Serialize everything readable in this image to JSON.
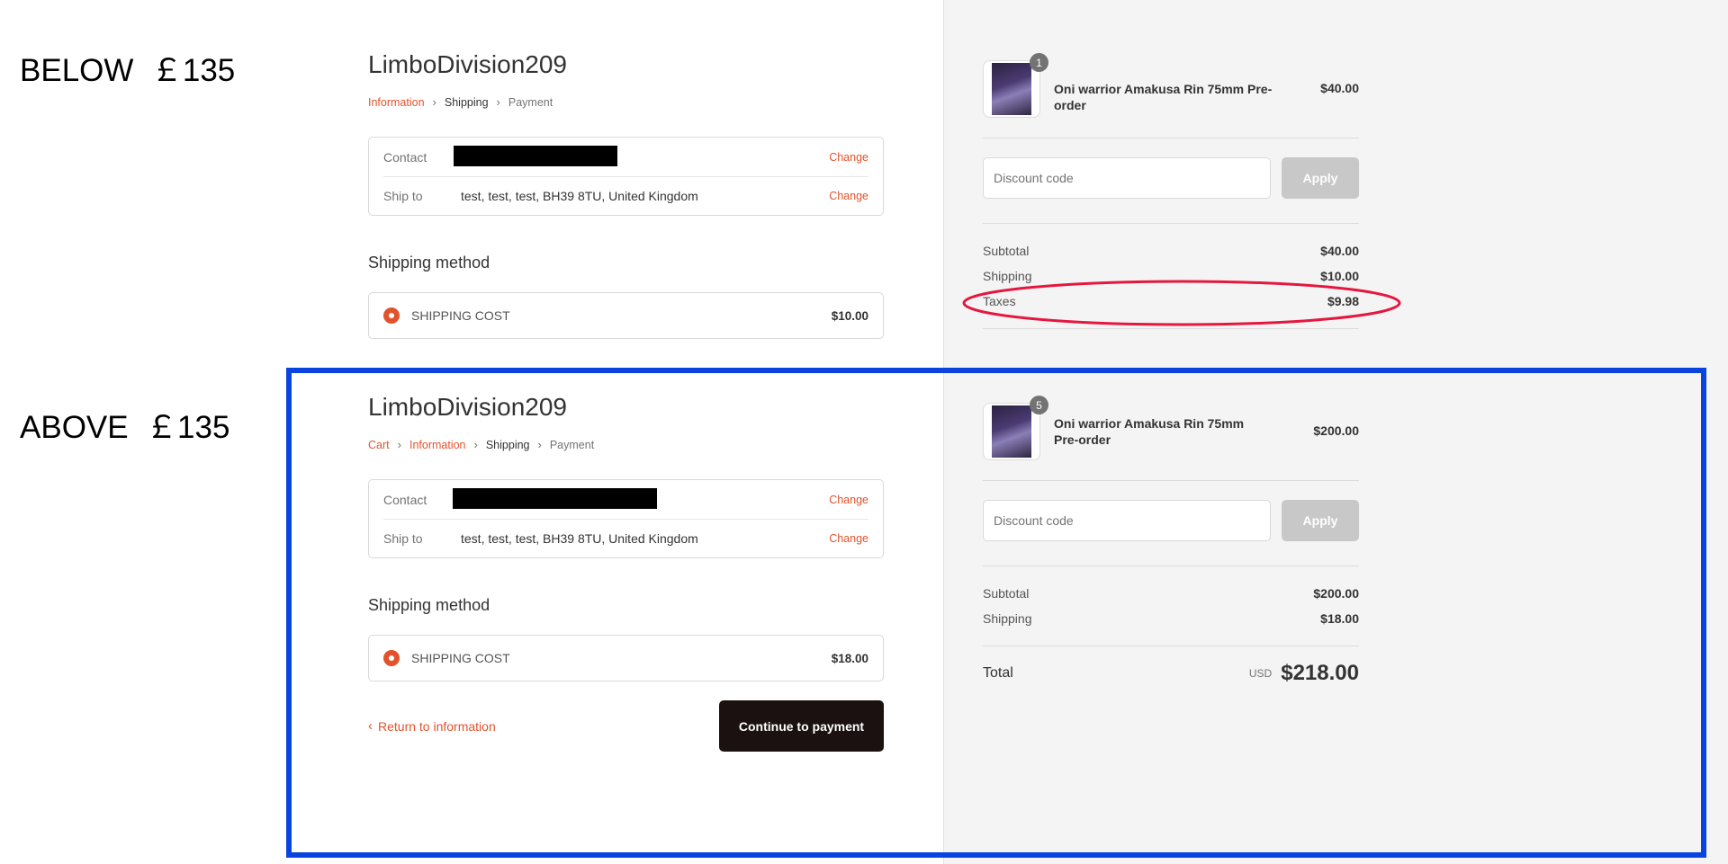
{
  "annotations": {
    "below_label": "BELOW  ￡135",
    "above_label": "ABOVE  ￡135",
    "highlight_color": "#e5173f",
    "frame_color": "#0a44e0"
  },
  "colors": {
    "accent": "#e2532d",
    "button_dark": "#1a1110",
    "panel_bg": "#f4f4f4"
  },
  "top": {
    "shop_title": "LimboDivision209",
    "breadcrumb": {
      "information": "Information",
      "shipping": "Shipping",
      "payment": "Payment"
    },
    "contact": {
      "label": "Contact",
      "change": "Change"
    },
    "ship_to": {
      "label": "Ship to",
      "value": "test, test, test, BH39 8TU, United Kingdom",
      "change": "Change"
    },
    "shipping_method_title": "Shipping method",
    "shipping_option": {
      "name": "SHIPPING COST",
      "price": "$10.00"
    },
    "order": {
      "product_name": "Oni warrior Amakusa Rin 75mm Pre-order",
      "product_price": "$40.00",
      "quantity": "1",
      "discount_placeholder": "Discount code",
      "apply_label": "Apply",
      "subtotal_label": "Subtotal",
      "subtotal_value": "$40.00",
      "shipping_label": "Shipping",
      "shipping_value": "$10.00",
      "taxes_label": "Taxes",
      "taxes_value": "$9.98"
    }
  },
  "bottom": {
    "shop_title": "LimboDivision209",
    "breadcrumb": {
      "cart": "Cart",
      "information": "Information",
      "shipping": "Shipping",
      "payment": "Payment"
    },
    "contact": {
      "label": "Contact",
      "change": "Change"
    },
    "ship_to": {
      "label": "Ship to",
      "value": "test, test, test, BH39 8TU, United Kingdom",
      "change": "Change"
    },
    "shipping_method_title": "Shipping method",
    "shipping_option": {
      "name": "SHIPPING COST",
      "price": "$18.00"
    },
    "return_link": "Return to information",
    "continue_button": "Continue to payment",
    "order": {
      "product_name": "Oni warrior Amakusa Rin 75mm Pre-order",
      "product_price": "$200.00",
      "quantity": "5",
      "discount_placeholder": "Discount code",
      "apply_label": "Apply",
      "subtotal_label": "Subtotal",
      "subtotal_value": "$200.00",
      "shipping_label": "Shipping",
      "shipping_value": "$18.00",
      "total_label": "Total",
      "total_currency": "USD",
      "total_value": "$218.00"
    }
  }
}
